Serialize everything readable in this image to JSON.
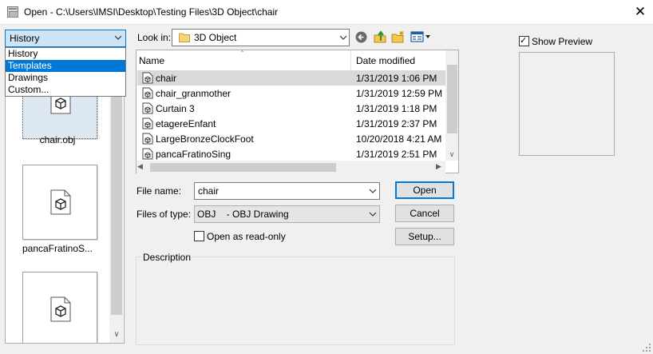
{
  "window": {
    "title": "Open - C:\\Users\\IMSI\\Desktop\\Testing Files\\3D Object\\chair",
    "close_glyph": "✕"
  },
  "places": {
    "selected": "History",
    "options": [
      "History",
      "Templates",
      "Drawings",
      "Custom..."
    ],
    "highlighted": "Templates"
  },
  "thumbnails": [
    {
      "label": "chair.obj",
      "selected": true
    },
    {
      "label": "pancaFratinoS...",
      "selected": false
    },
    {
      "label": "",
      "selected": false
    }
  ],
  "look_in": {
    "label": "Look in:",
    "value": "3D Object"
  },
  "toolbar": {
    "icons": [
      "back-icon",
      "up-folder-icon",
      "new-folder-icon",
      "views-menu-icon"
    ]
  },
  "file_list": {
    "columns": {
      "name": "Name",
      "date": "Date modified"
    },
    "rows": [
      {
        "name": "chair",
        "date": "1/31/2019 1:06 PM",
        "selected": true
      },
      {
        "name": "chair_granmother",
        "date": "1/31/2019 12:59 PM",
        "selected": false
      },
      {
        "name": "Curtain 3",
        "date": "1/31/2019 1:18 PM",
        "selected": false
      },
      {
        "name": "etagereEnfant",
        "date": "1/31/2019 2:37 PM",
        "selected": false
      },
      {
        "name": "LargeBronzeClockFoot",
        "date": "10/20/2018 4:21 AM",
        "selected": false
      },
      {
        "name": "pancaFratinoSing",
        "date": "1/31/2019 2:51 PM",
        "selected": false
      }
    ]
  },
  "file_name": {
    "label": "File name:",
    "value": "chair"
  },
  "file_type": {
    "label": "Files of type:",
    "value": "OBJ    - OBJ Drawing"
  },
  "read_only": {
    "label": "Open as read-only",
    "checked": false
  },
  "buttons": {
    "open": "Open",
    "cancel": "Cancel",
    "setup": "Setup..."
  },
  "description": {
    "label": "Description"
  },
  "preview": {
    "label": "Show Preview",
    "checked": true
  },
  "colors": {
    "accent": "#0078d7",
    "selection_bg": "#cce4f7"
  }
}
